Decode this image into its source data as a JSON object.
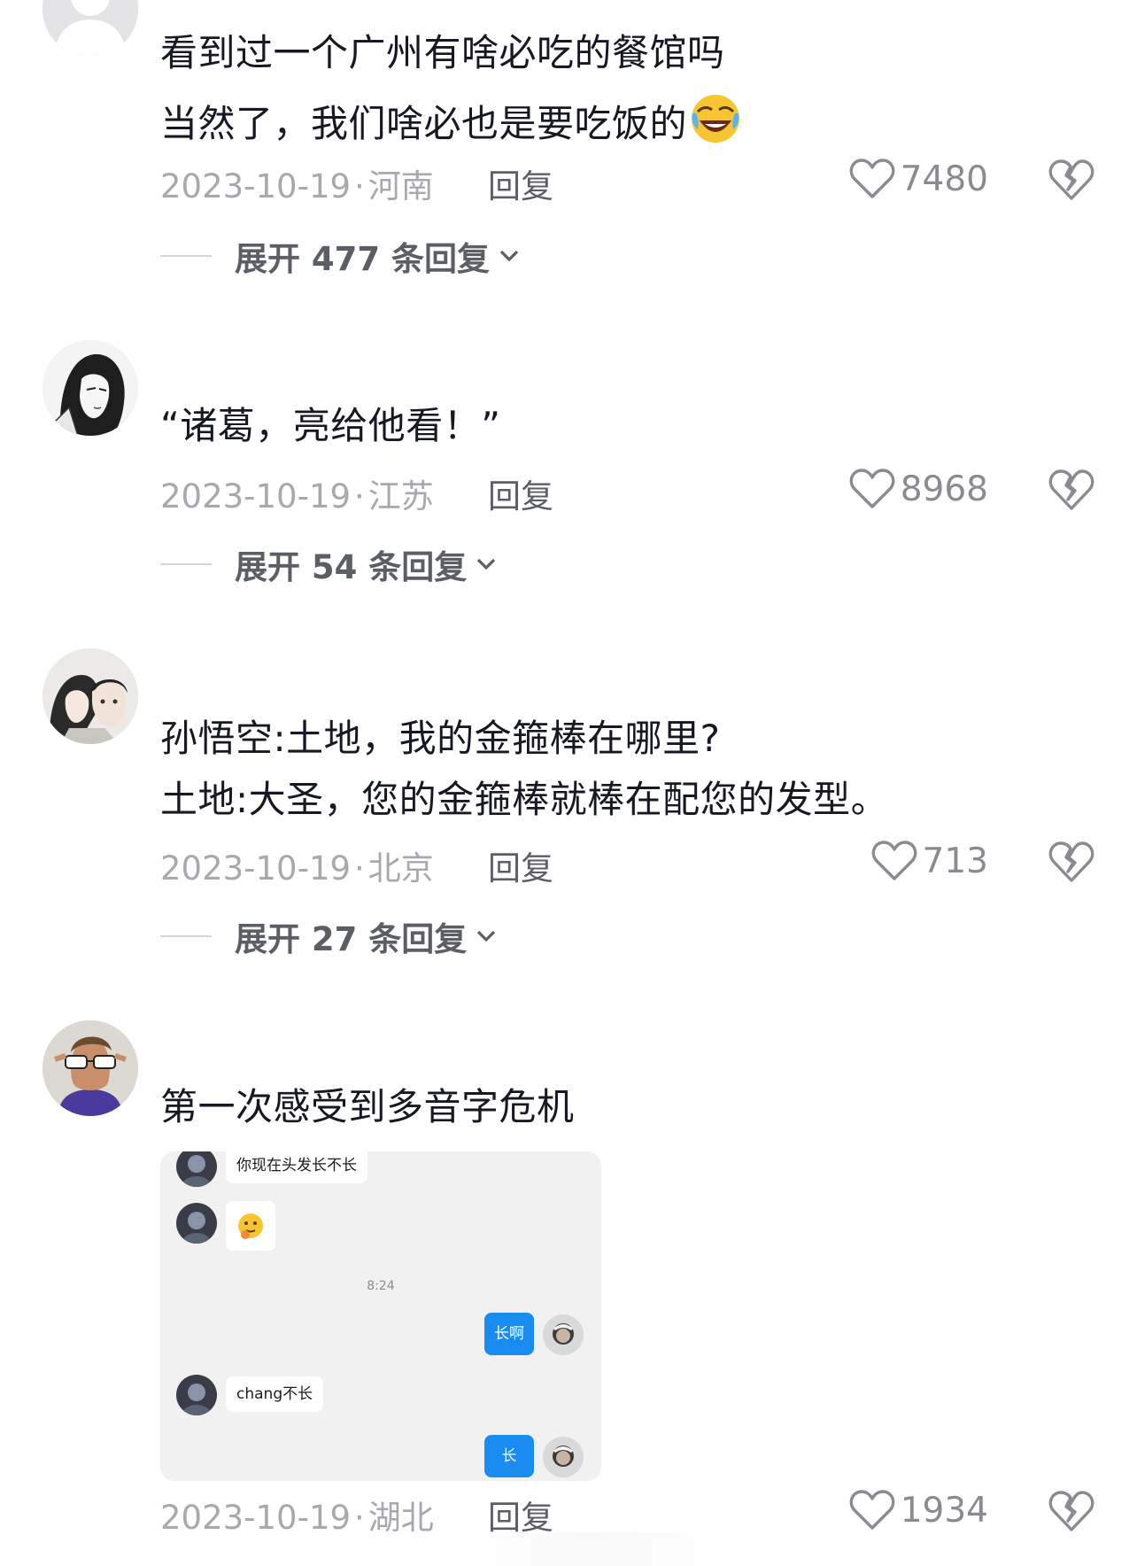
{
  "comments": [
    {
      "lines": [
        "看到过一个广州有啥必吃的餐馆吗",
        "当然了，我们啥必也是要吃饭的"
      ],
      "emoji": "laughing-crying-emoji",
      "date": "2023-10-19",
      "location": "河南",
      "reply_label": "回复",
      "likes": "7480",
      "expand_label": "展开 477 条回复"
    },
    {
      "lines": [
        "“诸葛，亮给他看！”"
      ],
      "date": "2023-10-19",
      "location": "江苏",
      "reply_label": "回复",
      "likes": "8968",
      "expand_label": "展开 54 条回复"
    },
    {
      "lines": [
        "孙悟空:土地，我的金箍棒在哪里?",
        "土地:大圣，您的金箍棒就棒在配您的发型。"
      ],
      "date": "2023-10-19",
      "location": "北京",
      "reply_label": "回复",
      "likes": "713",
      "expand_label": "展开 27 条回复"
    },
    {
      "lines": [
        "第一次感受到多音字危机"
      ],
      "date": "2023-10-19",
      "location": "湖北",
      "reply_label": "回复",
      "likes": "1934"
    }
  ],
  "chat_image": {
    "msg1": "你现在头发长不长",
    "msg2_emoji": "thinking-face-emoji",
    "time": "8:24",
    "msg3": "长啊",
    "msg4": "chang不长",
    "msg5": "长"
  },
  "colors": {
    "text": "#161823",
    "meta": "#a8a9ad",
    "accent_blue": "#1a8cf0"
  }
}
